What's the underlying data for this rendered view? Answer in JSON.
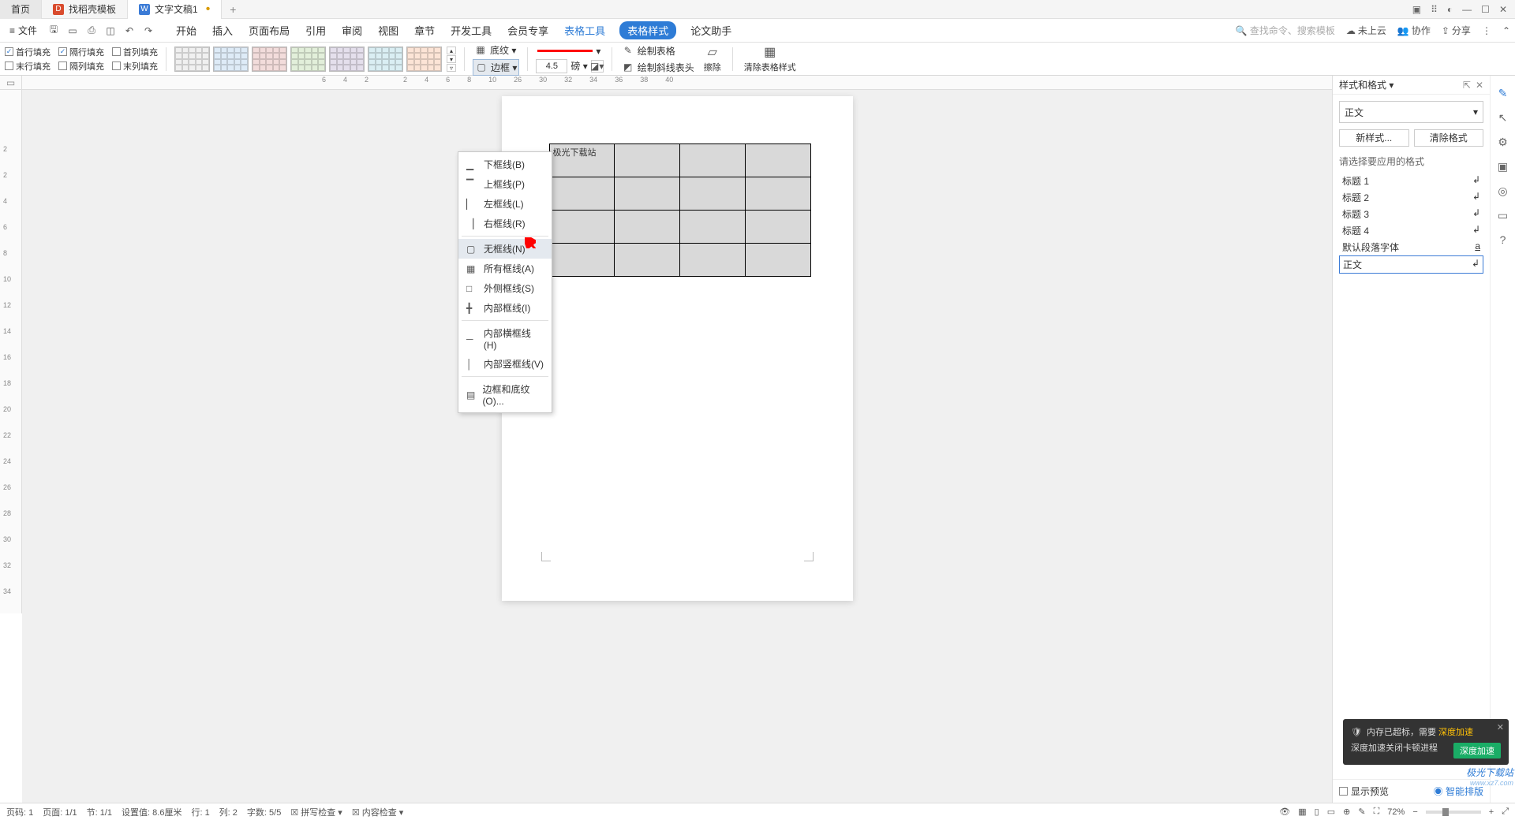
{
  "tabs": {
    "home": "首页",
    "tab1": "找稻壳模板",
    "tab2": "文字文稿1"
  },
  "menubar": {
    "file": "文件",
    "ribbonTabs": [
      "开始",
      "插入",
      "页面布局",
      "引用",
      "审阅",
      "视图",
      "章节",
      "开发工具",
      "会员专享"
    ],
    "ribbonTabBlue": "表格工具",
    "ribbonTabActive": "表格样式",
    "ribbonTabAfter": "论文助手",
    "searchCmd": "查找命令、搜索模板",
    "cloud": "未上云",
    "coop": "协作",
    "share": "分享"
  },
  "ribbon": {
    "chk1": "首行填充",
    "chk2": "隔行填充",
    "chk3": "首列填充",
    "chk4": "末行填充",
    "chk5": "隔列填充",
    "chk6": "末列填充",
    "shading": "底纹 ▾",
    "border": "边框 ▾",
    "borderWidth": "4.5",
    "borderUnit": "磅 ▾",
    "drawTable": "绘制表格",
    "drawDiag": "绘制斜线表头",
    "erase": "擦除",
    "clearStyle": "清除表格样式"
  },
  "borderMenu": {
    "i0": "下框线(B)",
    "i1": "上框线(P)",
    "i2": "左框线(L)",
    "i3": "右框线(R)",
    "i4": "无框线(N)",
    "i5": "所有框线(A)",
    "i6": "外侧框线(S)",
    "i7": "内部框线(I)",
    "i8": "内部横框线(H)",
    "i9": "内部竖框线(V)",
    "i10": "边框和底纹(O)..."
  },
  "hruler": [
    "6",
    "4",
    "2",
    "",
    "2",
    "4",
    "6",
    "8",
    "10",
    "",
    "",
    "",
    "",
    "",
    "",
    "",
    "",
    "26",
    "",
    "30",
    "32",
    "34",
    "36",
    "38",
    "40"
  ],
  "vruler": [
    "2",
    "2",
    "4",
    "6",
    "8",
    "10",
    "12",
    "14",
    "16",
    "18",
    "20",
    "22",
    "24",
    "26",
    "28",
    "30",
    "32",
    "34",
    "",
    "",
    "",
    "",
    "",
    "",
    ""
  ],
  "tableCell": "极光下载站",
  "stylePanel": {
    "title": "样式和格式 ▾",
    "current": "正文",
    "newBtn": "新样式...",
    "clearBtn": "清除格式",
    "applyLabel": "请选择要应用的格式",
    "items": [
      "标题 1",
      "标题 2",
      "标题 3",
      "标题 4",
      "默认段落字体",
      "正文"
    ],
    "showPreview": "显示预览",
    "smartLayout": "智能排版"
  },
  "toast": {
    "title1": "内存已超标，需要 ",
    "titleAccent": "深度加速",
    "line2": "深度加速关闭卡顿进程",
    "btn": "深度加速"
  },
  "statusbar": {
    "page": "页码: 1",
    "pages": "页面: 1/1",
    "section": "节: 1/1",
    "pos": "设置值: 8.6厘米",
    "row": "行: 1",
    "col": "列: 2",
    "words": "字数: 5/5",
    "spell": "拼写检查 ▾",
    "content": "内容检查 ▾",
    "zoom": "72%"
  },
  "watermark": {
    "line1": "极光下载站",
    "line2": "www.xz7.com"
  }
}
